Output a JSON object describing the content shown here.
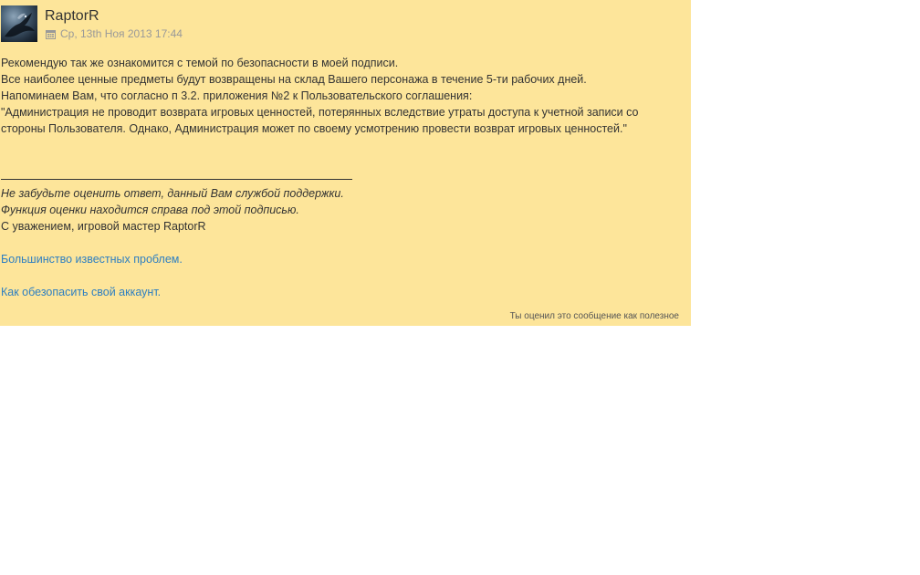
{
  "post": {
    "author": "RaptorR",
    "date": "Ср, 13th Ноя 2013 17:44",
    "body": [
      "Рекомендую так же ознакомится с темой по безопасности в моей подписи.",
      "Все наиболее ценные предметы будут возвращены на склад Вашего персонажа в течение 5-ти рабочих дней.",
      "Напоминаем Вам, что согласно п 3.2. приложения №2 к Пользовательского соглашения:",
      "\"Администрация не проводит возврата игровых ценностей, потерянных вследствие утраты доступа к учетной записи со",
      "стороны Пользователя. Однако, Администрация может по своему усмотрению провести возврат игровых ценностей.\""
    ],
    "signature": {
      "italic_line_1": "Не забудьте оценить ответ, данный Вам службой поддержки.",
      "italic_line_2": "Функция оценки находится справа под этой подписью.",
      "regards": "С уважением, игровой мастер RaptorR",
      "link_1": "Большинство известных проблем.",
      "link_2": "Как обезопасить свой аккаунт."
    },
    "rated_text": "Ты оценил это сообщение как полезное"
  },
  "icons": {
    "avatar": "dragon-avatar",
    "date": "calendar-icon"
  }
}
